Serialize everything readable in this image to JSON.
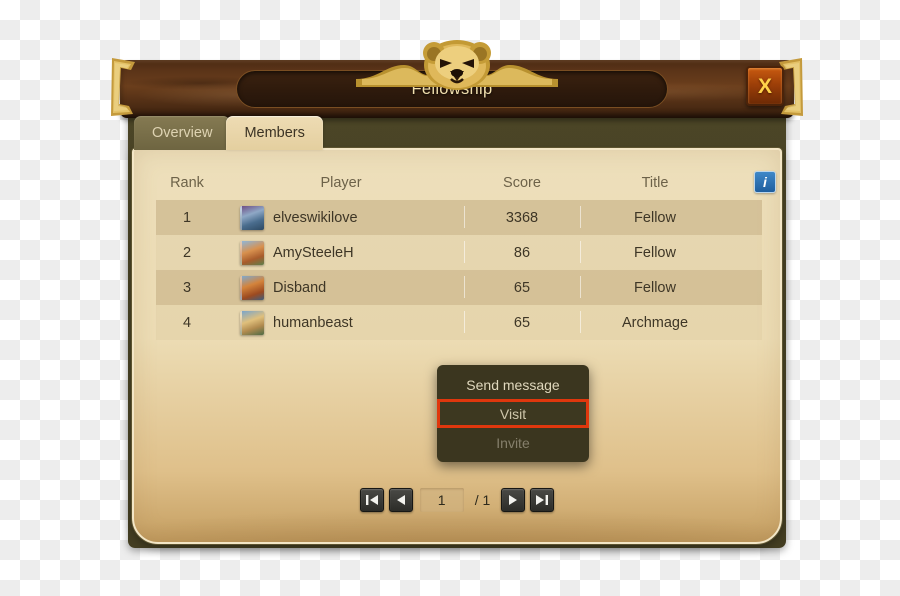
{
  "window": {
    "title": "Fellowship",
    "close_label": "X",
    "ornament": "lion-head-ornament"
  },
  "tabs": [
    {
      "label": "Overview",
      "active": false
    },
    {
      "label": "Members",
      "active": true
    }
  ],
  "table": {
    "headers": {
      "rank": "Rank",
      "player": "Player",
      "score": "Score",
      "title": "Title"
    },
    "info_icon_label": "i",
    "rows": [
      {
        "rank": "1",
        "player": "elveswikilove",
        "score": "3368",
        "title": "Fellow"
      },
      {
        "rank": "2",
        "player": "AmySteeleH",
        "score": "86",
        "title": "Fellow"
      },
      {
        "rank": "3",
        "player": "Disband",
        "score": "65",
        "title": "Fellow"
      },
      {
        "rank": "4",
        "player": "humanbeast",
        "score": "65",
        "title": "Archmage"
      }
    ]
  },
  "context_menu": {
    "items": [
      {
        "label": "Send message",
        "state": "normal"
      },
      {
        "label": "Visit",
        "state": "selected"
      },
      {
        "label": "Invite",
        "state": "disabled"
      }
    ]
  },
  "pagination": {
    "first_label": "first-page",
    "prev_label": "previous-page",
    "current_page": "1",
    "total_label": "/ 1",
    "next_label": "next-page",
    "last_label": "last-page"
  },
  "colors": {
    "accent_red": "#e0370d",
    "gold": "#ffd24a",
    "parchment": "#ecdcb4",
    "wood": "#5b3418",
    "info_blue": "#1f5e9e"
  }
}
